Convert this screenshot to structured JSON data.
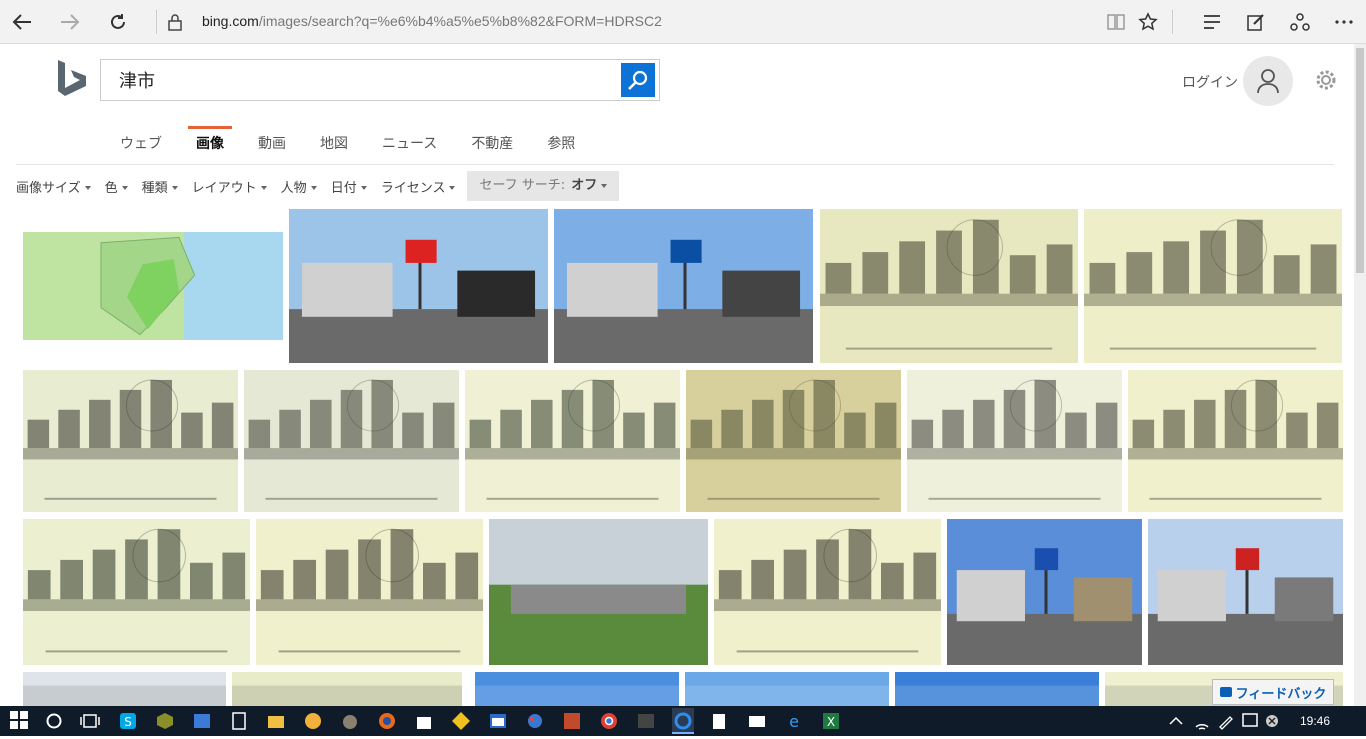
{
  "browser": {
    "url_host": "bing.com",
    "url_path": "/images/search?q=%e6%b4%a5%e5%b8%82&FORM=HDRSC2"
  },
  "bing": {
    "query": "津市",
    "login_label": "ログイン",
    "tabs": [
      {
        "label": "ウェブ",
        "active": false
      },
      {
        "label": "画像",
        "active": true
      },
      {
        "label": "動画",
        "active": false
      },
      {
        "label": "地図",
        "active": false
      },
      {
        "label": "ニュース",
        "active": false
      },
      {
        "label": "不動産",
        "active": false
      },
      {
        "label": "参照",
        "active": false
      }
    ],
    "filters": [
      "画像サイズ",
      "色",
      "種類",
      "レイアウト",
      "人物",
      "日付",
      "ライセンス"
    ],
    "safesearch_label": "セーフ サーチ:",
    "safesearch_value": "オフ"
  },
  "results": [
    {
      "kind": "map",
      "colors": [
        "#bfe3a0",
        "#7fd160",
        "#a8d8f0"
      ]
    },
    {
      "kind": "street-signs",
      "colors": [
        "#9cc4e8",
        "#d22",
        "#2a2a2a"
      ]
    },
    {
      "kind": "street-sign-blue",
      "colors": [
        "#7eaee6",
        "#0a4fa3",
        "#444"
      ]
    },
    {
      "kind": "old-bridge",
      "colors": [
        "#e8e8c0",
        "#3a3a2a"
      ]
    },
    {
      "kind": "old-bridge",
      "colors": [
        "#eeeec8",
        "#3a3a2a"
      ]
    },
    {
      "kind": "old-boats",
      "colors": [
        "#e8ecd0",
        "#303028"
      ]
    },
    {
      "kind": "old-town",
      "colors": [
        "#e4e8d4",
        "#3a3a30"
      ]
    },
    {
      "kind": "old-garden",
      "colors": [
        "#f0f0d4",
        "#2f3a28"
      ]
    },
    {
      "kind": "old-river",
      "colors": [
        "#d8d09c",
        "#4a4a34"
      ]
    },
    {
      "kind": "old-building",
      "colors": [
        "#eef0dc",
        "#3c3c34"
      ]
    },
    {
      "kind": "old-school",
      "colors": [
        "#f0f0cc",
        "#3a3a2a"
      ]
    },
    {
      "kind": "old-willow",
      "colors": [
        "#ecf0d0",
        "#2a3020"
      ]
    },
    {
      "kind": "old-bathing",
      "colors": [
        "#f0f0cc",
        "#2a2a20"
      ]
    },
    {
      "kind": "modern-building",
      "colors": [
        "#c8d0d8",
        "#5a8a3c",
        "#8a8a8a"
      ]
    },
    {
      "kind": "old-lotus",
      "colors": [
        "#f0f0cc",
        "#2a2a20"
      ]
    },
    {
      "kind": "construction",
      "colors": [
        "#5a8ed8",
        "#1a4fb0",
        "#a09070"
      ]
    },
    {
      "kind": "arcade",
      "colors": [
        "#b8d0ec",
        "#cc2222",
        "#7a7a7a"
      ]
    },
    {
      "kind": "partial",
      "colors": [
        "#dfe4ea",
        "#444"
      ]
    },
    {
      "kind": "partial",
      "colors": [
        "#e8ecc8",
        "#333"
      ]
    },
    {
      "kind": "partial",
      "colors": [
        "#4a8ee0",
        "#ffffff"
      ]
    },
    {
      "kind": "partial",
      "colors": [
        "#6aa8e8",
        "#ffffff"
      ]
    },
    {
      "kind": "partial",
      "colors": [
        "#3a80d8",
        "#ffffff"
      ]
    },
    {
      "kind": "partial",
      "colors": [
        "#eef0d0",
        "#333"
      ]
    }
  ],
  "feedback_label": "フィードバック",
  "taskbar": {
    "time": "19:46"
  }
}
